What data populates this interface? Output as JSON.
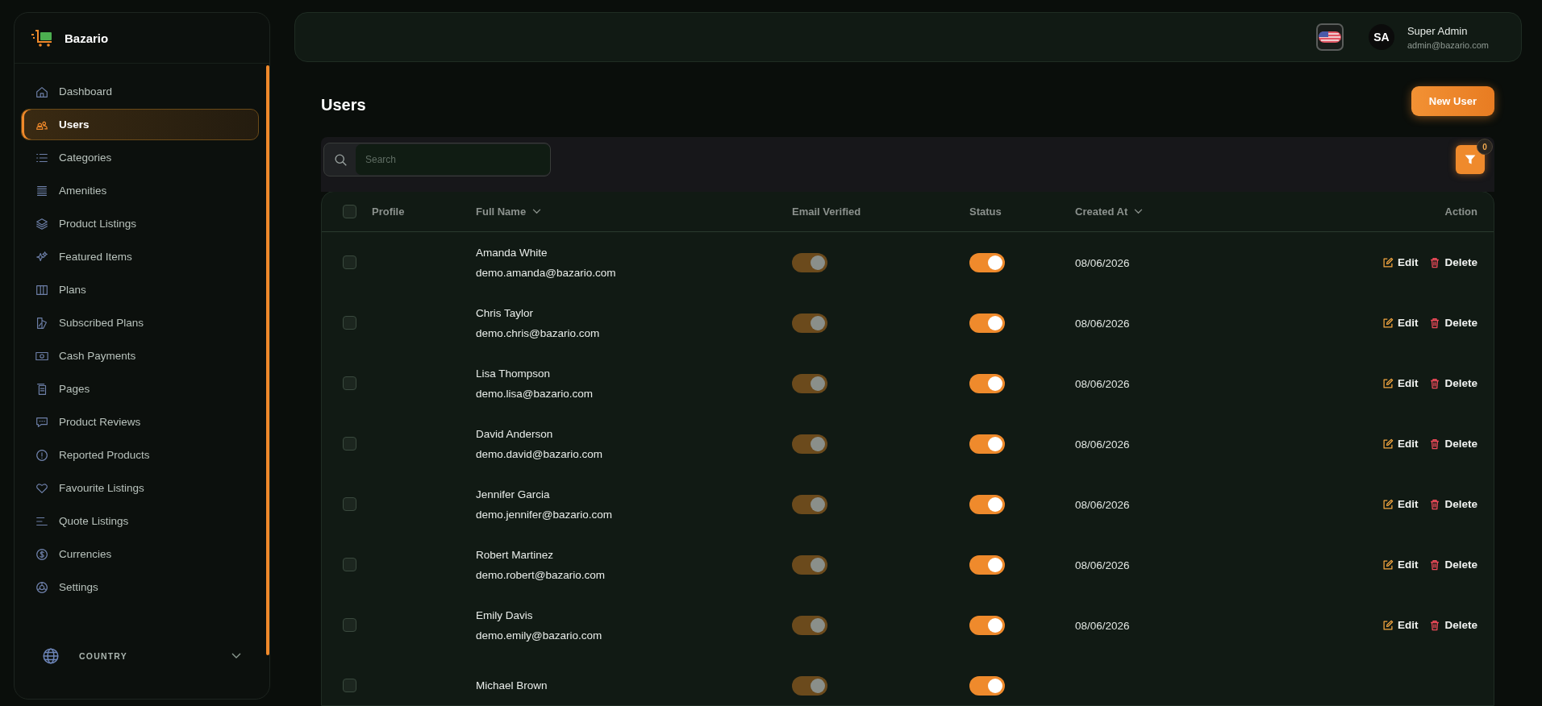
{
  "brand": {
    "name": "Bazario"
  },
  "sidebar": {
    "items": [
      {
        "label": "Dashboard",
        "selected": false
      },
      {
        "label": "Users",
        "selected": true
      },
      {
        "label": "Categories",
        "selected": false
      },
      {
        "label": "Amenities",
        "selected": false
      },
      {
        "label": "Product Listings",
        "selected": false
      },
      {
        "label": "Featured Items",
        "selected": false
      },
      {
        "label": "Plans",
        "selected": false
      },
      {
        "label": "Subscribed Plans",
        "selected": false
      },
      {
        "label": "Cash Payments",
        "selected": false
      },
      {
        "label": "Pages",
        "selected": false
      },
      {
        "label": "Product Reviews",
        "selected": false
      },
      {
        "label": "Reported Products",
        "selected": false
      },
      {
        "label": "Favourite Listings",
        "selected": false
      },
      {
        "label": "Quote Listings",
        "selected": false
      },
      {
        "label": "Currencies",
        "selected": false
      },
      {
        "label": "Settings",
        "selected": false
      }
    ],
    "country": {
      "label": "COUNTRY",
      "expanded": false
    }
  },
  "header": {
    "user": {
      "initials": "SA",
      "name": "Super Admin",
      "email": "admin@bazario.com"
    }
  },
  "page": {
    "title": "Users",
    "new_button": "New User"
  },
  "search": {
    "placeholder": "Search"
  },
  "filter": {
    "count": "0"
  },
  "table": {
    "columns": [
      {
        "label": "Profile",
        "sortable": false
      },
      {
        "label": "Full Name",
        "sortable": true
      },
      {
        "label": "Email Verified",
        "sortable": false
      },
      {
        "label": "Status",
        "sortable": false
      },
      {
        "label": "Created At",
        "sortable": true
      },
      {
        "label": "Action",
        "sortable": false
      }
    ],
    "select_all": {
      "checked": false
    },
    "rows": [
      {
        "name": "Amanda White",
        "email": "demo.amanda@bazario.com",
        "checked": false,
        "email_verified": {
          "on": true,
          "disabled": true
        },
        "status": {
          "on": true
        },
        "created": "08/06/2026",
        "edit": "Edit",
        "delete": "Delete"
      },
      {
        "name": "Chris Taylor",
        "email": "demo.chris@bazario.com",
        "checked": false,
        "email_verified": {
          "on": true,
          "disabled": true
        },
        "status": {
          "on": true
        },
        "created": "08/06/2026",
        "edit": "Edit",
        "delete": "Delete"
      },
      {
        "name": "Lisa Thompson",
        "email": "demo.lisa@bazario.com",
        "checked": false,
        "email_verified": {
          "on": true,
          "disabled": true
        },
        "status": {
          "on": true
        },
        "created": "08/06/2026",
        "edit": "Edit",
        "delete": "Delete"
      },
      {
        "name": "David Anderson",
        "email": "demo.david@bazario.com",
        "checked": false,
        "email_verified": {
          "on": true,
          "disabled": true
        },
        "status": {
          "on": true
        },
        "created": "08/06/2026",
        "edit": "Edit",
        "delete": "Delete"
      },
      {
        "name": "Jennifer Garcia",
        "email": "demo.jennifer@bazario.com",
        "checked": false,
        "email_verified": {
          "on": true,
          "disabled": true
        },
        "status": {
          "on": true
        },
        "created": "08/06/2026",
        "edit": "Edit",
        "delete": "Delete"
      },
      {
        "name": "Robert Martinez",
        "email": "demo.robert@bazario.com",
        "checked": false,
        "email_verified": {
          "on": true,
          "disabled": true
        },
        "status": {
          "on": true
        },
        "created": "08/06/2026",
        "edit": "Edit",
        "delete": "Delete"
      },
      {
        "name": "Emily Davis",
        "email": "demo.emily@bazario.com",
        "checked": false,
        "email_verified": {
          "on": true,
          "disabled": true
        },
        "status": {
          "on": true
        },
        "created": "08/06/2026",
        "edit": "Edit",
        "delete": "Delete"
      },
      {
        "name": "Michael Brown",
        "checked": false,
        "email_verified": {
          "on": true,
          "disabled": true
        },
        "status": {
          "on": true
        }
      }
    ]
  }
}
